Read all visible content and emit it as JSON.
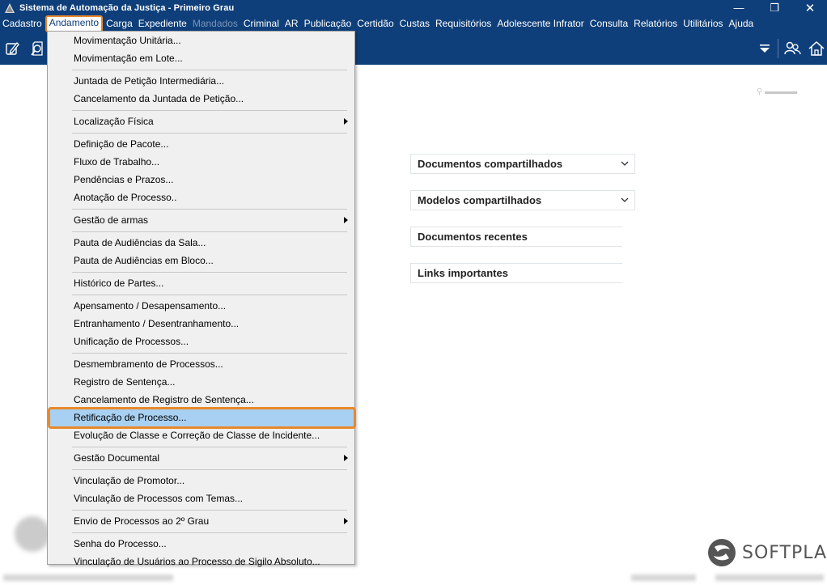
{
  "window": {
    "title": "Sistema de Automação da Justiça - Primeiro Grau",
    "min_glyph": "—",
    "max_glyph": "❐",
    "close_glyph": "✕"
  },
  "menubar": [
    {
      "label": "Cadastro",
      "state": "normal"
    },
    {
      "label": "Andamento",
      "state": "active"
    },
    {
      "label": "Carga",
      "state": "normal"
    },
    {
      "label": "Expediente",
      "state": "normal"
    },
    {
      "label": "Mandados",
      "state": "disabled"
    },
    {
      "label": "Criminal",
      "state": "normal"
    },
    {
      "label": "AR",
      "state": "normal"
    },
    {
      "label": "Publicação",
      "state": "normal"
    },
    {
      "label": "Certidão",
      "state": "normal"
    },
    {
      "label": "Custas",
      "state": "normal"
    },
    {
      "label": "Requisitórios",
      "state": "normal"
    },
    {
      "label": "Adolescente Infrator",
      "state": "normal"
    },
    {
      "label": "Consulta",
      "state": "normal"
    },
    {
      "label": "Relatórios",
      "state": "normal"
    },
    {
      "label": "Utilitários",
      "state": "normal"
    },
    {
      "label": "Ajuda",
      "state": "normal"
    }
  ],
  "toolbar": {
    "icons": [
      "edit-icon",
      "search-document-icon",
      "dropdown-arrow-icon",
      "users-icon",
      "home-icon"
    ]
  },
  "andamento_menu": [
    {
      "type": "item",
      "label": "Movimentação Unitária..."
    },
    {
      "type": "item",
      "label": "Movimentação em Lote..."
    },
    {
      "type": "sep"
    },
    {
      "type": "item",
      "label": "Juntada de Petição Intermediária..."
    },
    {
      "type": "item",
      "label": "Cancelamento da Juntada de Petição..."
    },
    {
      "type": "sep"
    },
    {
      "type": "item",
      "label": "Localização Física",
      "submenu": true
    },
    {
      "type": "sep"
    },
    {
      "type": "item",
      "label": "Definição de Pacote..."
    },
    {
      "type": "item",
      "label": "Fluxo de Trabalho..."
    },
    {
      "type": "item",
      "label": "Pendências e Prazos..."
    },
    {
      "type": "item",
      "label": "Anotação de Processo.."
    },
    {
      "type": "sep"
    },
    {
      "type": "item",
      "label": "Gestão de armas",
      "submenu": true
    },
    {
      "type": "sep"
    },
    {
      "type": "item",
      "label": "Pauta de Audiências da Sala..."
    },
    {
      "type": "item",
      "label": "Pauta de Audiências em Bloco..."
    },
    {
      "type": "sep"
    },
    {
      "type": "item",
      "label": "Histórico de Partes..."
    },
    {
      "type": "sep"
    },
    {
      "type": "item",
      "label": "Apensamento / Desapensamento..."
    },
    {
      "type": "item",
      "label": "Entranhamento / Desentranhamento..."
    },
    {
      "type": "item",
      "label": "Unificação de Processos..."
    },
    {
      "type": "sep"
    },
    {
      "type": "item",
      "label": "Desmembramento de Processos..."
    },
    {
      "type": "item",
      "label": "Registro de Sentença..."
    },
    {
      "type": "item",
      "label": "Cancelamento de Registro de Sentença..."
    },
    {
      "type": "item",
      "label": "Retificação de Processo...",
      "highlighted": true
    },
    {
      "type": "item",
      "label": "Evolução de Classe e Correção de Classe de Incidente..."
    },
    {
      "type": "sep"
    },
    {
      "type": "item",
      "label": "Gestão Documental",
      "submenu": true
    },
    {
      "type": "sep"
    },
    {
      "type": "item",
      "label": "Vinculação de Promotor..."
    },
    {
      "type": "item",
      "label": "Vinculação de Processos com Temas..."
    },
    {
      "type": "sep"
    },
    {
      "type": "item",
      "label": "Envio de Processos ao 2º Grau",
      "submenu": true
    },
    {
      "type": "sep"
    },
    {
      "type": "item",
      "label": "Senha do Processo..."
    },
    {
      "type": "item",
      "label": "Vinculação de Usuários ao Processo de Sigilo Absoluto..."
    }
  ],
  "panels": [
    {
      "label": "Documentos compartilhados",
      "chevron": true
    },
    {
      "label": "Modelos compartilhados",
      "chevron": true
    },
    {
      "label": "Documentos recentes",
      "chevron": false
    },
    {
      "label": "Links importantes",
      "chevron": false
    }
  ],
  "logo": {
    "text": "SOFTPLAN"
  },
  "colors": {
    "bar": "#0f3f7a",
    "highlight": "#a8d0f2",
    "accent": "#e8892b"
  }
}
